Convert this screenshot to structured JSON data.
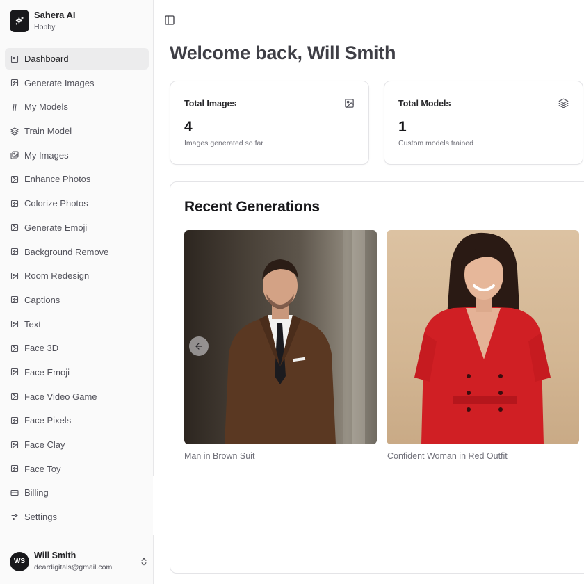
{
  "brand": {
    "name": "Sahera AI",
    "plan": "Hobby",
    "icon": "sparkle-icon"
  },
  "nav": [
    {
      "label": "Dashboard",
      "icon": "dashboard-icon",
      "active": true
    },
    {
      "label": "Generate Images",
      "icon": "image-icon"
    },
    {
      "label": "My Models",
      "icon": "hash-icon"
    },
    {
      "label": "Train Model",
      "icon": "layers-icon"
    },
    {
      "label": "My Images",
      "icon": "images-icon"
    },
    {
      "label": "Enhance Photos",
      "icon": "image-icon"
    },
    {
      "label": "Colorize Photos",
      "icon": "image-icon"
    },
    {
      "label": "Generate Emoji",
      "icon": "image-icon"
    },
    {
      "label": "Background Remove",
      "icon": "image-icon"
    },
    {
      "label": "Room Redesign",
      "icon": "image-icon"
    },
    {
      "label": "Captions",
      "icon": "image-icon"
    },
    {
      "label": "Text",
      "icon": "image-icon"
    },
    {
      "label": "Face 3D",
      "icon": "image-icon"
    },
    {
      "label": "Face Emoji",
      "icon": "image-icon"
    },
    {
      "label": "Face Video Game",
      "icon": "image-icon"
    },
    {
      "label": "Face Pixels",
      "icon": "image-icon"
    },
    {
      "label": "Face Clay",
      "icon": "image-icon"
    },
    {
      "label": "Face Toy",
      "icon": "image-icon"
    },
    {
      "label": "Billing",
      "icon": "credit-card-icon"
    },
    {
      "label": "Settings",
      "icon": "sliders-icon"
    }
  ],
  "user": {
    "initials": "WS",
    "name": "Will Smith",
    "email": "deardigitals@gmail.com"
  },
  "header": {
    "title": "Welcome back, Will Smith"
  },
  "stats": [
    {
      "title": "Total Images",
      "value": "4",
      "subtitle": "Images generated so far",
      "icon": "image-icon"
    },
    {
      "title": "Total Models",
      "value": "1",
      "subtitle": "Custom models trained",
      "icon": "layers-icon"
    }
  ],
  "recent": {
    "title": "Recent Generations",
    "items": [
      {
        "caption": "Man in Brown Suit"
      },
      {
        "caption": "Confident Woman in Red Outfit"
      }
    ]
  }
}
